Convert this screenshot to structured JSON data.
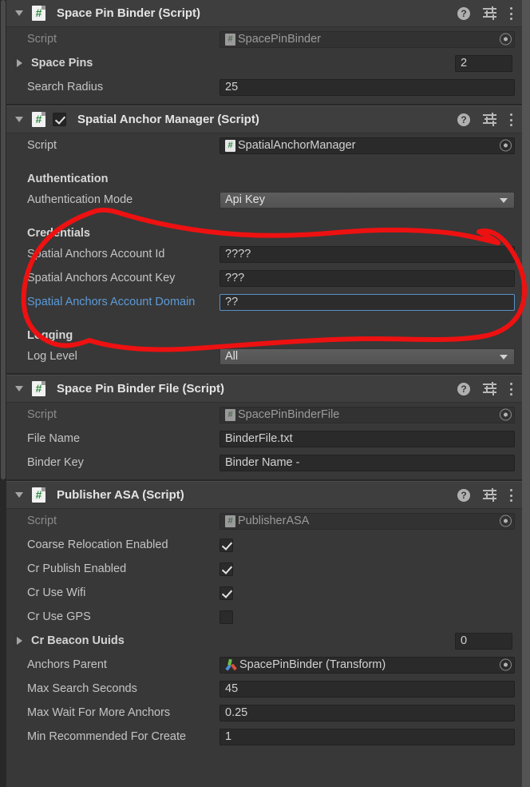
{
  "window": {
    "title": "Unity Inspector",
    "background": "#383838",
    "header_background": "#3e3e3e",
    "accent_focus": "#5b8fc9",
    "annotation_color": "#ee1111"
  },
  "icons": {
    "foldout_open": "triangle-down-icon",
    "foldout_closed": "triangle-right-icon",
    "script": "csharp-script-icon",
    "help": "help-icon",
    "preset": "preset-settings-icon",
    "menu": "kebab-menu-icon",
    "object_picker": "object-picker-icon",
    "transform": "transform-gizmo-icon",
    "dropdown": "chevron-down-icon"
  },
  "components": [
    {
      "id": "space-pin-binder",
      "title": "Space Pin Binder (Script)",
      "expanded": true,
      "has_enable_checkbox": false,
      "rows": [
        {
          "kind": "object",
          "label": "Script",
          "label_style": "dim",
          "value": "SpacePinBinder",
          "readonly": true,
          "icon": "csharp-script-icon"
        },
        {
          "kind": "array",
          "label": "Space Pins",
          "label_style": "bold",
          "expanded": false,
          "count": "2"
        },
        {
          "kind": "text",
          "label": "Search Radius",
          "label_style": "normal",
          "value": "25"
        }
      ]
    },
    {
      "id": "spatial-anchor-manager",
      "title": "Spatial Anchor Manager (Script)",
      "expanded": true,
      "has_enable_checkbox": true,
      "enabled": true,
      "rows": [
        {
          "kind": "object",
          "label": "Script",
          "label_style": "normal",
          "value": "SpatialAnchorManager",
          "readonly": false,
          "icon": "csharp-script-icon"
        },
        {
          "kind": "spacer"
        },
        {
          "kind": "section",
          "label": "Authentication"
        },
        {
          "kind": "dropdown",
          "label": "Authentication Mode",
          "label_style": "normal",
          "value": "Api Key"
        },
        {
          "kind": "spacer"
        },
        {
          "kind": "section",
          "label": "Credentials"
        },
        {
          "kind": "text",
          "label": "Spatial Anchors Account Id",
          "label_style": "normal",
          "value": "????"
        },
        {
          "kind": "text",
          "label": "Spatial Anchors Account Key",
          "label_style": "normal",
          "value": "???"
        },
        {
          "kind": "text",
          "label": "Spatial Anchors Account Domain",
          "label_style": "link",
          "value": "??",
          "focused": true
        },
        {
          "kind": "spacer"
        },
        {
          "kind": "section",
          "label": "Logging"
        },
        {
          "kind": "dropdown",
          "label": "Log Level",
          "label_style": "normal",
          "value": "All"
        }
      ]
    },
    {
      "id": "space-pin-binder-file",
      "title": "Space Pin Binder File (Script)",
      "expanded": true,
      "has_enable_checkbox": false,
      "rows": [
        {
          "kind": "object",
          "label": "Script",
          "label_style": "dim",
          "value": "SpacePinBinderFile",
          "readonly": true,
          "icon": "csharp-script-icon"
        },
        {
          "kind": "text",
          "label": "File Name",
          "label_style": "normal",
          "value": "BinderFile.txt"
        },
        {
          "kind": "text",
          "label": "Binder Key",
          "label_style": "normal",
          "value": "Binder Name -"
        }
      ]
    },
    {
      "id": "publisher-asa",
      "title": "Publisher ASA (Script)",
      "expanded": true,
      "has_enable_checkbox": false,
      "rows": [
        {
          "kind": "object",
          "label": "Script",
          "label_style": "dim",
          "value": "PublisherASA",
          "readonly": true,
          "icon": "csharp-script-icon"
        },
        {
          "kind": "checkbox",
          "label": "Coarse Relocation Enabled",
          "label_style": "normal",
          "checked": true
        },
        {
          "kind": "checkbox",
          "label": "Cr Publish Enabled",
          "label_style": "normal",
          "checked": true
        },
        {
          "kind": "checkbox",
          "label": "Cr Use Wifi",
          "label_style": "normal",
          "checked": true
        },
        {
          "kind": "checkbox",
          "label": "Cr Use GPS",
          "label_style": "normal",
          "checked": false
        },
        {
          "kind": "array",
          "label": "Cr Beacon Uuids",
          "label_style": "bold",
          "expanded": false,
          "count": "0"
        },
        {
          "kind": "object",
          "label": "Anchors Parent",
          "label_style": "normal",
          "value": "SpacePinBinder (Transform)",
          "readonly": false,
          "icon": "transform-gizmo-icon"
        },
        {
          "kind": "text",
          "label": "Max Search Seconds",
          "label_style": "normal",
          "value": "45"
        },
        {
          "kind": "text",
          "label": "Max Wait For More Anchors",
          "label_style": "normal",
          "value": "0.25"
        },
        {
          "kind": "text",
          "label": "Min Recommended For Create",
          "label_style": "normal",
          "value": "1"
        }
      ]
    }
  ],
  "annotation": {
    "name": "red-circle-highlight-credentials",
    "color": "#ee1111",
    "stroke_width": 6,
    "description": "Hand-drawn red loop around the Credentials group"
  }
}
